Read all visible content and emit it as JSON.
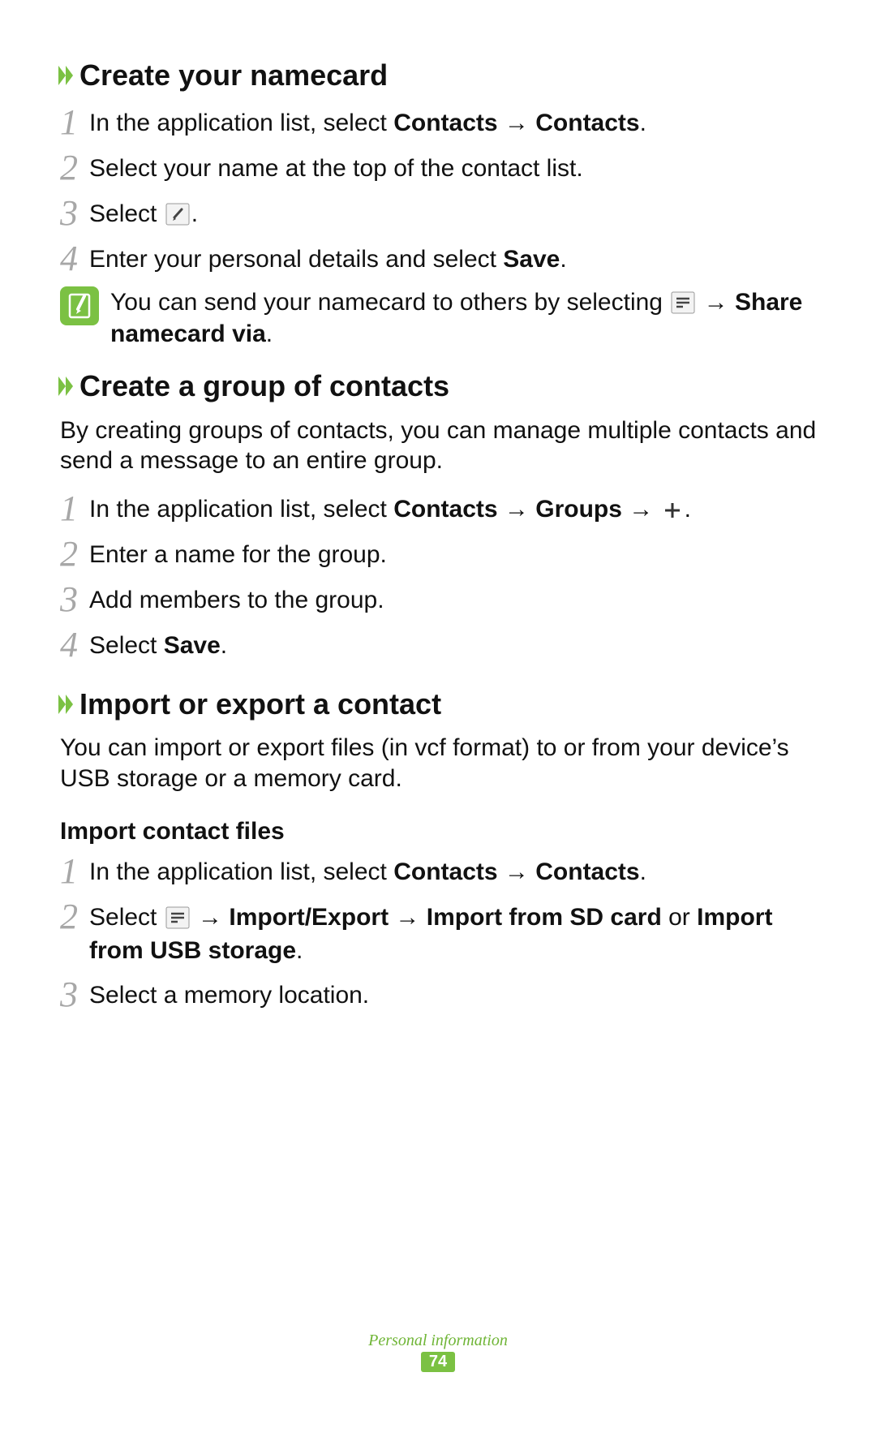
{
  "sections": [
    {
      "heading": "Create your namecard",
      "intro": null,
      "steps": [
        {
          "num": "1",
          "html": "In the application list, select <b>Contacts</b> → <b>Contacts</b>."
        },
        {
          "num": "2",
          "html": "Select your name at the top of the contact list."
        },
        {
          "num": "3",
          "html": "Select {EDIT_ICON}."
        },
        {
          "num": "4",
          "html": "Enter your personal details and select <b>Save</b>."
        }
      ],
      "note": {
        "html": "You can send your namecard to others by selecting {MENU_ICON} → <b>Share namecard via</b>."
      }
    },
    {
      "heading": "Create a group of contacts",
      "intro": "By creating groups of contacts, you can manage multiple contacts and send a message to an entire group.",
      "steps": [
        {
          "num": "1",
          "html": "In the application list, select <b>Contacts</b> → <b>Groups</b> → {PLUS_ICON}."
        },
        {
          "num": "2",
          "html": "Enter a name for the group."
        },
        {
          "num": "3",
          "html": "Add members to the group."
        },
        {
          "num": "4",
          "html": "Select <b>Save</b>."
        }
      ]
    },
    {
      "heading": "Import or export a contact",
      "intro": "You can import or export files (in vcf format) to or from your device’s USB storage or a memory card.",
      "subheading": "Import contact files",
      "steps": [
        {
          "num": "1",
          "html": "In the application list, select <b>Contacts</b> → <b>Contacts</b>."
        },
        {
          "num": "2",
          "html": "Select {MENU_ICON} → <b>Import/Export</b> → <b>Import from SD card</b> or <b>Import from USB storage</b>."
        },
        {
          "num": "3",
          "html": "Select a memory location."
        }
      ]
    }
  ],
  "footer": {
    "section_name": "Personal information",
    "page_number": "74"
  },
  "icons": {
    "edit": "edit-icon",
    "menu": "menu-icon",
    "plus": "plus-icon",
    "note": "note-icon",
    "chevron": "chevron-icon"
  }
}
